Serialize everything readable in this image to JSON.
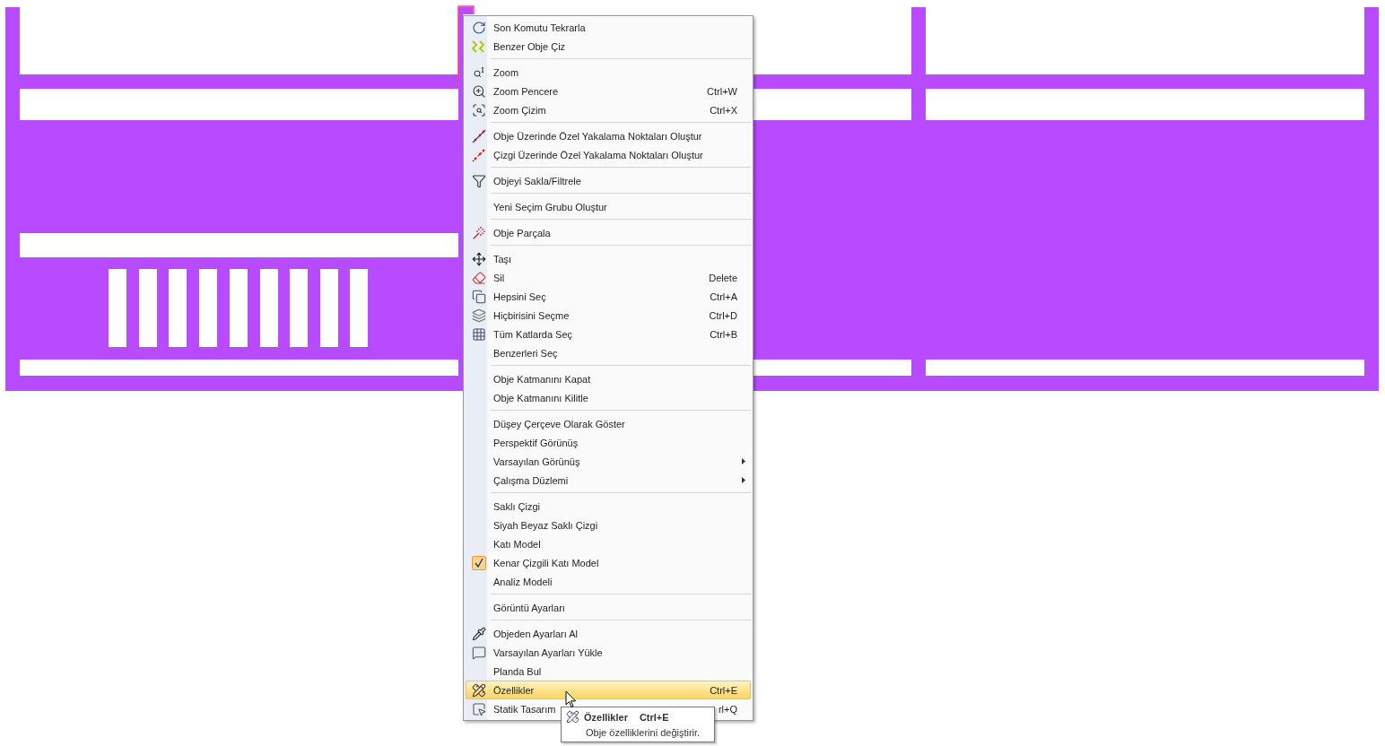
{
  "menu": {
    "items": [
      {
        "kind": "item",
        "label": "Son Komutu Tekrarla",
        "checked": false,
        "selected": false,
        "submenu": false
      },
      {
        "kind": "item",
        "label": "Benzer Obje Çiz",
        "checked": false,
        "selected": false,
        "submenu": false
      },
      {
        "kind": "separator"
      },
      {
        "kind": "item",
        "label": "Zoom",
        "checked": false,
        "selected": false,
        "submenu": false
      },
      {
        "kind": "item",
        "label": "Zoom Pencere",
        "shortcut": "Ctrl+W",
        "checked": false,
        "selected": false,
        "submenu": false
      },
      {
        "kind": "item",
        "label": "Zoom Çizim",
        "shortcut": "Ctrl+X",
        "checked": false,
        "selected": false,
        "submenu": false
      },
      {
        "kind": "separator"
      },
      {
        "kind": "item",
        "label": "Obje Üzerinde Özel Yakalama Noktaları Oluştur",
        "checked": false,
        "selected": false,
        "submenu": false
      },
      {
        "kind": "item",
        "label": "Çizgi Üzerinde Özel Yakalama Noktaları Oluştur",
        "checked": false,
        "selected": false,
        "submenu": false
      },
      {
        "kind": "separator"
      },
      {
        "kind": "item",
        "label": "Objeyi Sakla/Filtrele",
        "checked": false,
        "selected": false,
        "submenu": false
      },
      {
        "kind": "separator"
      },
      {
        "kind": "item",
        "label": "Yeni Seçim Grubu Oluştur",
        "checked": false,
        "selected": false,
        "submenu": false
      },
      {
        "kind": "separator"
      },
      {
        "kind": "item",
        "label": "Obje Parçala",
        "checked": false,
        "selected": false,
        "submenu": false
      },
      {
        "kind": "separator"
      },
      {
        "kind": "item",
        "label": "Taşı",
        "checked": false,
        "selected": false,
        "submenu": false
      },
      {
        "kind": "item",
        "label": "Sil",
        "shortcut": "Delete",
        "checked": false,
        "selected": false,
        "submenu": false
      },
      {
        "kind": "item",
        "label": "Hepsini Seç",
        "shortcut": "Ctrl+A",
        "checked": false,
        "selected": false,
        "submenu": false
      },
      {
        "kind": "item",
        "label": "Hiçbirisini Seçme",
        "shortcut": "Ctrl+D",
        "checked": false,
        "selected": false,
        "submenu": false
      },
      {
        "kind": "item",
        "label": "Tüm Katlarda Seç",
        "shortcut": "Ctrl+B",
        "checked": false,
        "selected": false,
        "submenu": false
      },
      {
        "kind": "item",
        "label": "Benzerleri Seç",
        "checked": false,
        "selected": false,
        "submenu": false
      },
      {
        "kind": "separator"
      },
      {
        "kind": "item",
        "label": "Obje Katmanını Kapat",
        "checked": false,
        "selected": false,
        "submenu": false
      },
      {
        "kind": "item",
        "label": "Obje Katmanını Kilitle",
        "checked": false,
        "selected": false,
        "submenu": false
      },
      {
        "kind": "separator"
      },
      {
        "kind": "item",
        "label": "Düşey Çerçeve Olarak Göster",
        "checked": false,
        "selected": false,
        "submenu": false
      },
      {
        "kind": "item",
        "label": "Perspektif Görünüş",
        "checked": false,
        "selected": false,
        "submenu": false
      },
      {
        "kind": "item",
        "label": "Varsayılan Görünüş",
        "checked": false,
        "selected": false,
        "submenu": true
      },
      {
        "kind": "item",
        "label": "Çalışma Düzlemi",
        "checked": false,
        "selected": false,
        "submenu": true
      },
      {
        "kind": "separator"
      },
      {
        "kind": "item",
        "label": "Saklı Çizgi",
        "checked": false,
        "selected": false,
        "submenu": false
      },
      {
        "kind": "item",
        "label": "Siyah Beyaz Saklı Çizgi",
        "checked": false,
        "selected": false,
        "submenu": false
      },
      {
        "kind": "item",
        "label": "Katı Model",
        "checked": false,
        "selected": false,
        "submenu": false
      },
      {
        "kind": "item",
        "label": "Kenar Çizgili Katı Model",
        "checked": true,
        "selected": false,
        "submenu": false
      },
      {
        "kind": "item",
        "label": "Analiz Modeli",
        "checked": false,
        "selected": false,
        "submenu": false
      },
      {
        "kind": "separator"
      },
      {
        "kind": "item",
        "label": "Görüntü Ayarları",
        "checked": false,
        "selected": false,
        "submenu": false
      },
      {
        "kind": "separator"
      },
      {
        "kind": "item",
        "label": "Objeden Ayarları Al",
        "checked": false,
        "selected": false,
        "submenu": false
      },
      {
        "kind": "item",
        "label": "Varsayılan Ayarları Yükle",
        "checked": false,
        "selected": false,
        "submenu": false
      },
      {
        "kind": "item",
        "label": "Planda Bul",
        "checked": false,
        "selected": false,
        "submenu": false
      },
      {
        "kind": "item",
        "label": "Özellikler",
        "shortcut": "Ctrl+E",
        "checked": false,
        "selected": true,
        "submenu": false
      },
      {
        "kind": "item",
        "label": "Statik Tasarım",
        "shortcut": "rl+Q",
        "checked": false,
        "selected": false,
        "submenu": false
      }
    ]
  },
  "tooltip": {
    "title": "Özellikler",
    "shortcut": "Ctrl+E",
    "description": "Obje özelliklerini değiştirir."
  }
}
